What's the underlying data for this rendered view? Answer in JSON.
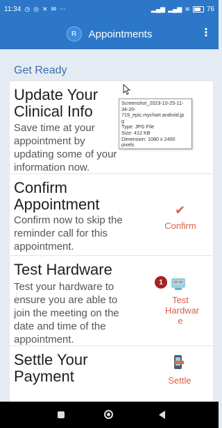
{
  "status_bar": {
    "time": "11:34",
    "left_icons": [
      "alarm-icon",
      "whatsapp-icon",
      "x-icon",
      "message-icon",
      "more-icon"
    ],
    "battery": "76"
  },
  "app_bar": {
    "avatar_initial": "R",
    "title": "Appointments",
    "menu_icon": "vertical-dots-icon"
  },
  "section_title": "Get Ready",
  "cards": [
    {
      "title_lines": [
        "Update Your",
        "Clinical Info"
      ],
      "desc_lines": [
        "Save time at your",
        "appointment by",
        "updating some of your",
        "information now."
      ]
    },
    {
      "title_lines": [
        "Confirm",
        "Appointment"
      ],
      "desc_lines": [
        "Confirm now to skip the",
        "reminder call for this",
        "appointment."
      ],
      "action_label": "Confirm",
      "action_icon": "checkmark-icon"
    },
    {
      "title_lines": [
        "Test Hardware"
      ],
      "desc_lines": [
        "Test your hardware to",
        "ensure you are able to",
        "join the meeting on the",
        "date and time of the",
        "appointment."
      ],
      "action_label_lines": [
        "Test",
        "Hardwar",
        "e"
      ],
      "action_icon": "computer-icon",
      "badge": "1"
    },
    {
      "title_lines": [
        "Settle Your",
        "Payment"
      ],
      "action_label": "Settle",
      "action_icon": "phone-payment-icon"
    }
  ],
  "tooltip": {
    "lines": [
      "Screenshot_2023-10-25-11-",
      "34-20-",
      "719_epic.mychart.android.jp",
      "g",
      "Type: JPG File",
      "Size: 412 KB",
      "Dimension: 1080 x 2400",
      "pixels"
    ]
  },
  "nav_bar": {
    "buttons": [
      "recent-apps-icon",
      "home-icon",
      "back-icon"
    ]
  }
}
